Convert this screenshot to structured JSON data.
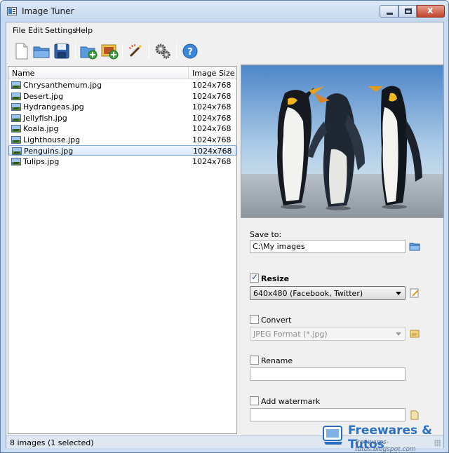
{
  "window": {
    "title": "Image Tuner",
    "close_glyph": "x"
  },
  "menu": {
    "file": "File",
    "edit": "Edit",
    "settings": "Settings",
    "help": "Help"
  },
  "toolbar": {
    "icons": [
      "new-file-icon",
      "open-folder-icon",
      "save-icon",
      "add-folder-icon",
      "add-image-icon",
      "process-wand-icon",
      "settings-gears-icon",
      "help-icon"
    ],
    "help_glyph": "?"
  },
  "file_list": {
    "columns": [
      "Name",
      "Image Size"
    ],
    "rows": [
      {
        "name": "Chrysanthemum.jpg",
        "size": "1024x768"
      },
      {
        "name": "Desert.jpg",
        "size": "1024x768"
      },
      {
        "name": "Hydrangeas.jpg",
        "size": "1024x768"
      },
      {
        "name": "Jellyfish.jpg",
        "size": "1024x768"
      },
      {
        "name": "Koala.jpg",
        "size": "1024x768"
      },
      {
        "name": "Lighthouse.jpg",
        "size": "1024x768"
      },
      {
        "name": "Penguins.jpg",
        "size": "1024x768"
      },
      {
        "name": "Tulips.jpg",
        "size": "1024x768"
      }
    ],
    "selected": "Penguins.jpg"
  },
  "options": {
    "save_to_label": "Save to:",
    "save_to_value": "C:\\My images",
    "resize_label": "Resize",
    "resize_checked": true,
    "resize_value": "640x480 (Facebook, Twitter)",
    "convert_label": "Convert",
    "convert_checked": false,
    "convert_value": "JPEG Format (*.jpg)",
    "rename_label": "Rename",
    "rename_checked": false,
    "rename_value": "",
    "watermark_label": "Add watermark",
    "watermark_checked": false,
    "watermark_value": ""
  },
  "status": {
    "text": "8 images (1 selected)"
  },
  "watermark": {
    "title": "Freewares & Tutos",
    "url": "freewares-tutos.blogspot.com"
  },
  "colors": {
    "accent": "#2b6fc4",
    "selection": "#d9e9fb"
  }
}
